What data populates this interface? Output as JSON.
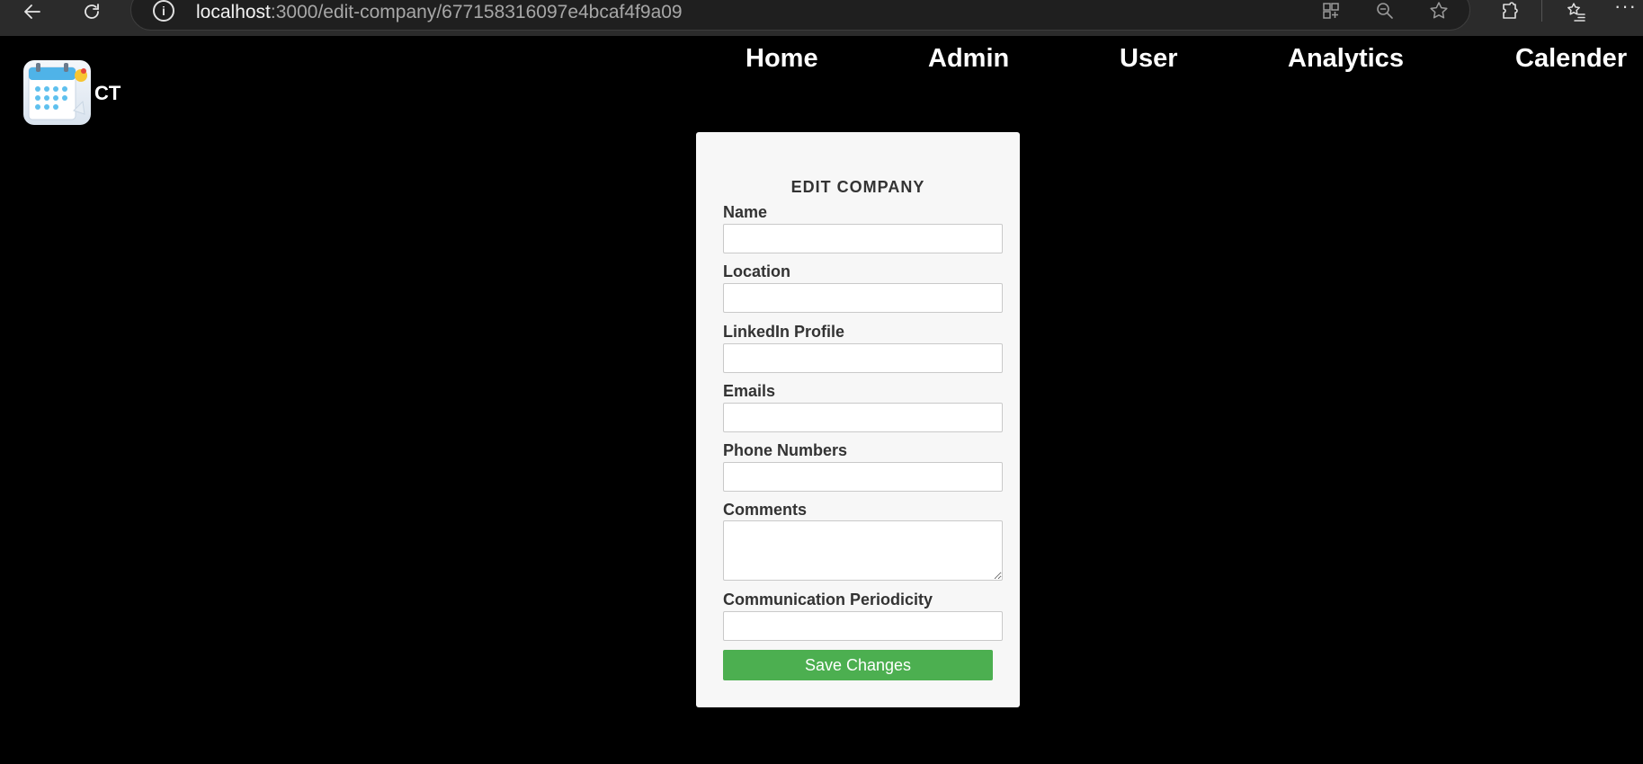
{
  "browser": {
    "url_host": "localhost",
    "url_path": ":3000/edit-company/677158316097e4bcaf4f9a09",
    "more_label": "···"
  },
  "app": {
    "logo_text": "CT",
    "nav": [
      {
        "label": "Home"
      },
      {
        "label": "Admin"
      },
      {
        "label": "User"
      },
      {
        "label": "Analytics"
      },
      {
        "label": "Calender"
      }
    ]
  },
  "form": {
    "title": "EDIT COMPANY",
    "fields": [
      {
        "label": "Name",
        "value": ""
      },
      {
        "label": "Location",
        "value": ""
      },
      {
        "label": "LinkedIn Profile",
        "value": ""
      },
      {
        "label": "Emails",
        "value": ""
      },
      {
        "label": "Phone Numbers",
        "value": ""
      },
      {
        "label": "Comments",
        "value": ""
      },
      {
        "label": "Communication Periodicity",
        "value": ""
      }
    ],
    "submit_label": "Save Changes"
  },
  "colors": {
    "page_background": "#000000",
    "card_background": "#f7f7f7",
    "save_button": "#4caf50",
    "browser_chrome": "#2b2b2b"
  },
  "icons": [
    "back-arrow-icon",
    "refresh-icon",
    "info-icon",
    "grid-apps-icon",
    "zoom-out-icon",
    "star-favorite-icon",
    "extensions-icon",
    "favorites-list-icon",
    "more-dots-icon",
    "calendar-logo-icon"
  ]
}
